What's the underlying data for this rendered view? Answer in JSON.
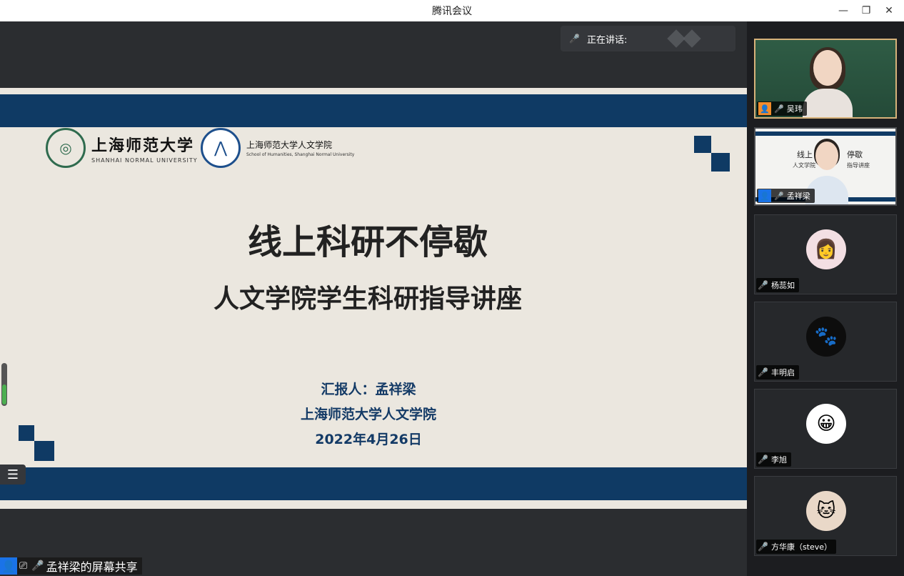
{
  "window": {
    "title": "腾讯会议",
    "controls": [
      "—",
      "❐",
      "✕"
    ]
  },
  "speaking": {
    "label": "正在讲话:"
  },
  "slide": {
    "logo1_cn": "上海师范大学",
    "logo1_en": "SHANHAI NORMAL UNIVERSITY",
    "logo2_cn": "上海师范大学人文学院",
    "logo2_en": "School of Humanities, Shanghai Normal University",
    "title": "线上科研不停歇",
    "subtitle": "人文学院学生科研指导讲座",
    "presenter": "汇报人：孟祥梁",
    "org": "上海师范大学人文学院",
    "date": "2022年4月26日"
  },
  "share_bar": {
    "label": "孟祥梁的屏幕共享"
  },
  "participants": [
    {
      "name": "吴玮",
      "type": "video"
    },
    {
      "name": "孟祥梁",
      "type": "video"
    },
    {
      "name": "杨蕊如",
      "type": "avatar"
    },
    {
      "name": "丰明启",
      "type": "avatar"
    },
    {
      "name": "李旭",
      "type": "avatar"
    },
    {
      "name": "方华康（steve）",
      "type": "avatar"
    }
  ],
  "mini_slide": {
    "text1": "线上",
    "text2": "停歇",
    "text3": "人文学院",
    "text4": "指导讲座"
  },
  "colors": {
    "accent": "#0f3a64",
    "active_border": "#d7b27a",
    "badge_orange": "#f08c2c",
    "badge_blue": "#1a73e8"
  }
}
